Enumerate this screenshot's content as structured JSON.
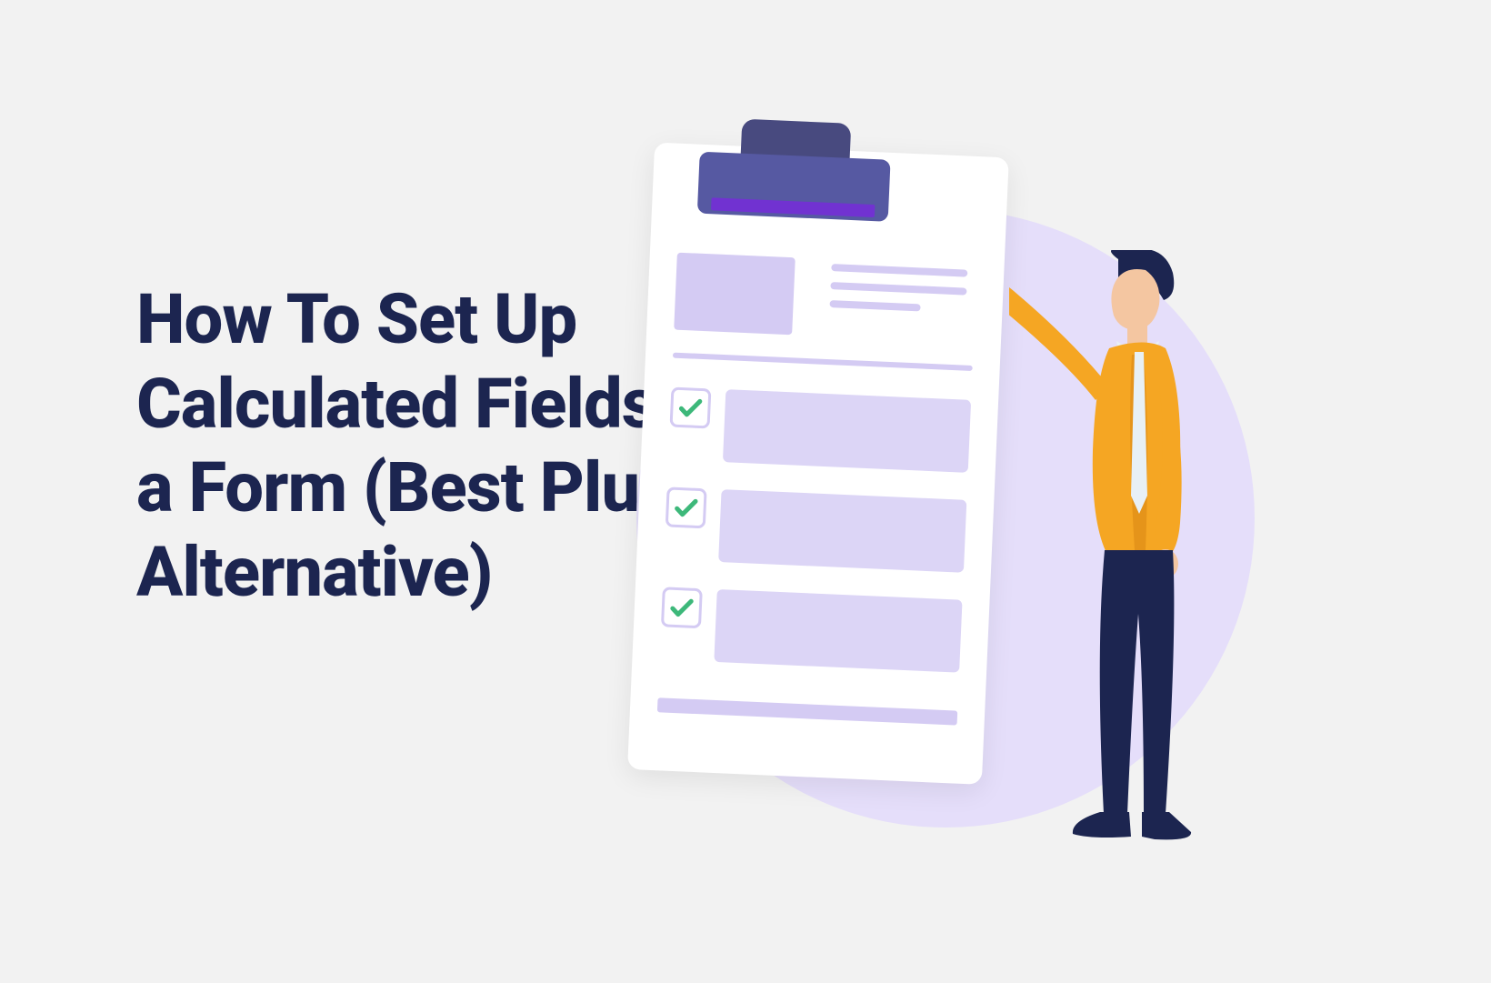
{
  "title": "How To Set Up Calculated Fields in a Form (Best Plugin Alternative)",
  "colors": {
    "titleColor": "#1c2550",
    "background": "#f2f2f2",
    "circleBg": "#e5defa",
    "formField": "#dcd5f6",
    "checkmark": "#3db87a",
    "personShirt": "#f5a623",
    "personPants": "#1c2550",
    "personSkin": "#f4c6a1",
    "clipDark": "#484a7f",
    "clipMid": "#5659a2",
    "clipAccent": "#7132d1"
  },
  "illustration": {
    "checklistItems": 3,
    "description": "person-writing-on-clipboard-checklist"
  }
}
